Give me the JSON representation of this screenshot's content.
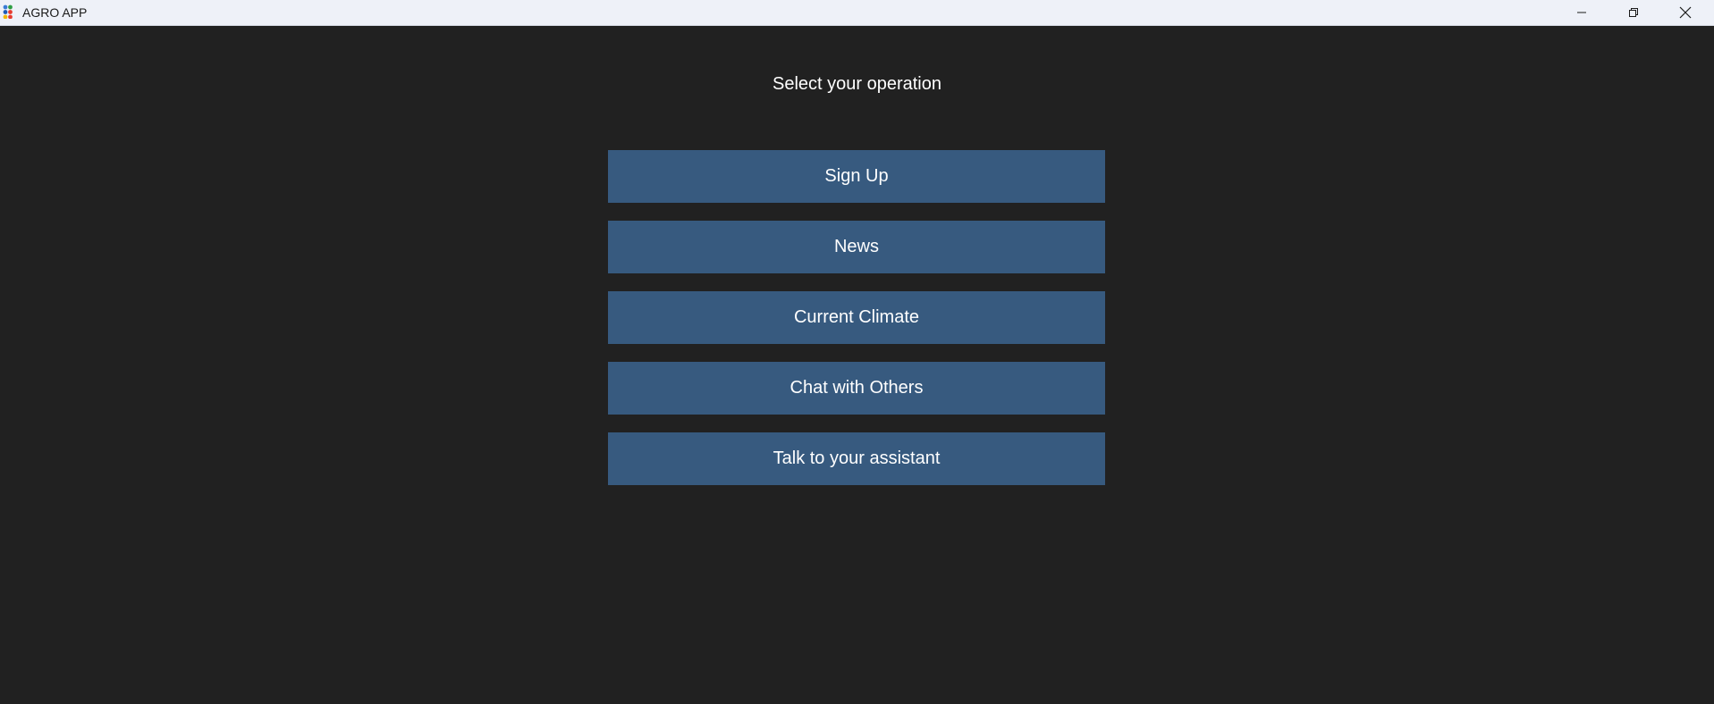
{
  "window": {
    "title": "AGRO APP",
    "icon": "app-grid-icon",
    "controls": {
      "minimize_icon": "minimize-icon",
      "maximize_icon": "restore-icon",
      "close_icon": "close-icon"
    }
  },
  "main": {
    "heading": "Select your operation",
    "buttons": [
      {
        "label": "Sign Up"
      },
      {
        "label": "News"
      },
      {
        "label": "Current Climate"
      },
      {
        "label": "Chat with Others"
      },
      {
        "label": "Talk to your assistant"
      }
    ]
  },
  "colors": {
    "background": "#212121",
    "titlebar": "#eef1f8",
    "button": "#375a7f",
    "text": "#ffffff"
  }
}
